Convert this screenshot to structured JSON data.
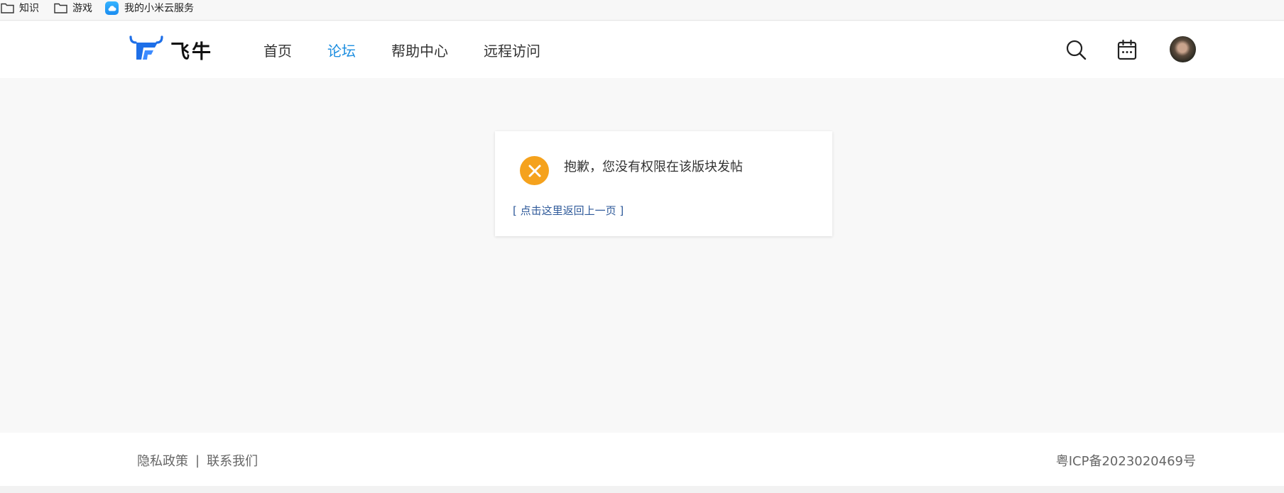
{
  "bookmarks": [
    {
      "label": "知识",
      "icon": "folder-icon"
    },
    {
      "label": "游戏",
      "icon": "folder-icon"
    },
    {
      "label": "我的小米云服务",
      "icon": "cloud-icon"
    }
  ],
  "header": {
    "logo_text": "飞牛",
    "nav": [
      {
        "label": "首页",
        "active": false
      },
      {
        "label": "论坛",
        "active": true
      },
      {
        "label": "帮助中心",
        "active": false
      },
      {
        "label": "远程访问",
        "active": false
      }
    ],
    "icons": [
      "search-icon",
      "calendar-icon",
      "avatar"
    ]
  },
  "message": {
    "text": "抱歉，您没有权限在该版块发帖",
    "back_link": "[ 点击这里返回上一页 ]",
    "icon": "error-x-icon"
  },
  "footer": {
    "privacy": "隐私政策",
    "separator": "|",
    "contact": "联系我们",
    "icp": "粤ICP备2023020469号"
  },
  "colors": {
    "accent": "#1d8ee0",
    "error_icon": "#f5a21d",
    "link": "#2f5a9a",
    "logo_blue": "#1e6fe8"
  }
}
